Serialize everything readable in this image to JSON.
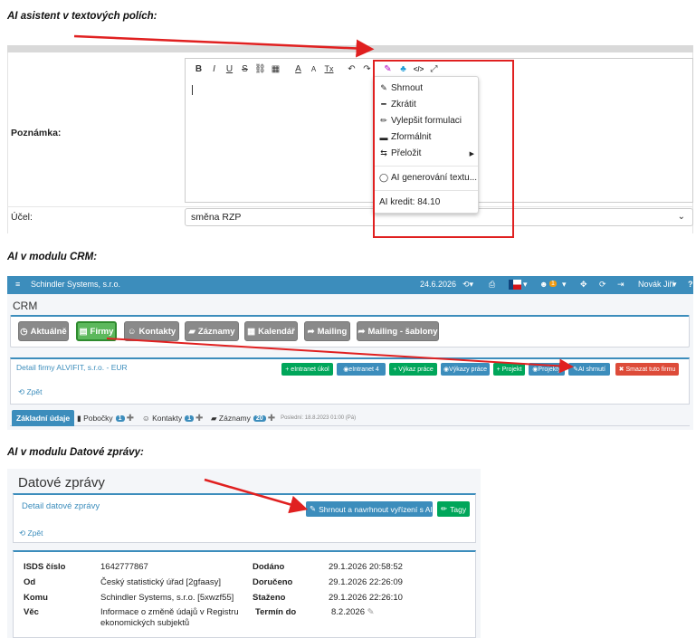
{
  "section_editor": {
    "heading": "AI asistent v textových polích:",
    "note_label": "Poznámka:",
    "purpose_label": "Účel:",
    "purpose_value": "směna RZP",
    "toolbar_glyphs": [
      "B",
      "I",
      "U",
      "S",
      "⛓",
      "▦",
      "A",
      "A",
      "Tx",
      "↶",
      "↷",
      "✎",
      "♣",
      "</>",
      "⤢"
    ],
    "ai_menu": {
      "items": [
        {
          "icon": "compress-icon",
          "glyph": "✎",
          "label": "Shrnout"
        },
        {
          "icon": "minus-icon",
          "glyph": "━",
          "label": "Zkrátit"
        },
        {
          "icon": "pencil-icon",
          "glyph": "✏",
          "label": "Vylepšit formulaci"
        },
        {
          "icon": "briefcase-icon",
          "glyph": "▬",
          "label": "Zformálnit"
        },
        {
          "icon": "translate-icon",
          "glyph": "⇆",
          "label": "Přeložit"
        }
      ],
      "generate_label": "AI generování textu...",
      "credit_label": "AI kredit: 84.10"
    }
  },
  "section_crm": {
    "heading": "AI v modulu CRM:",
    "nav": {
      "company": "Schindler Systems, s.r.o.",
      "date": "24.6.2026",
      "user": "Novák Jiří",
      "notif_count": "1",
      "help": "?"
    },
    "page_title": "CRM",
    "module_buttons": [
      "Aktuálně",
      "Firmy",
      "Kontakty",
      "Záznamy",
      "Kalendář",
      "Mailing",
      "Mailing - šablony"
    ],
    "detail_title": "Detail firmy ALVIFIT, s.r.o. - EUR",
    "back_label": "Zpět",
    "action_buttons": [
      {
        "label": "+ eIntranet úkol",
        "color": "green"
      },
      {
        "label": "eIntranet",
        "count": "4",
        "color": "blue"
      },
      {
        "label": "+ Výkaz práce",
        "color": "green"
      },
      {
        "label": "Výkazy práce",
        "color": "blue"
      },
      {
        "label": "+ Projekt",
        "color": "green"
      },
      {
        "label": "Projekty",
        "color": "blue"
      },
      {
        "label": "AI shrnutí",
        "color": "blue"
      },
      {
        "label": "✖ Smazat tuto firmu",
        "color": "red"
      }
    ],
    "tabs": [
      {
        "label": "Základní údaje"
      },
      {
        "label": "Pobočky",
        "count": "1"
      },
      {
        "label": "Kontakty",
        "count": "1"
      },
      {
        "label": "Záznamy",
        "count": "20",
        "note": "Poslední: 18.8.2023 01:00 (Pá)"
      }
    ]
  },
  "section_ds": {
    "heading": "AI v modulu Datové zprávy:",
    "page_title": "Datové zprávy",
    "detail_title": "Detail datové zprávy",
    "summary_button": "Shrnout a navrhnout vyřízení s AI",
    "tags_button": "Tagy",
    "back_label": "Zpět",
    "fields_left": [
      {
        "key": "ISDS číslo",
        "value": "1642777867"
      },
      {
        "key": "Od",
        "value": "Český statistický úřad [2gfaasy]"
      },
      {
        "key": "Komu",
        "value": "Schindler Systems, s.r.o. [5xwzf55]"
      },
      {
        "key": "Věc",
        "value": "Informace o změně údajů v Registru ekonomických subjektů"
      }
    ],
    "fields_right": [
      {
        "key": "Dodáno",
        "value": "29.1.2026 20:58:52"
      },
      {
        "key": "Doručeno",
        "value": "29.1.2026 22:26:09"
      },
      {
        "key": "Staženo",
        "value": "29.1.2026 22:26:10"
      },
      {
        "key": "Termín do",
        "value": "8.2.2026"
      }
    ]
  },
  "colors": {
    "accent": "#3c8dbc",
    "highlight": "#e02020",
    "success": "#00a65a",
    "danger": "#dd4b39"
  }
}
